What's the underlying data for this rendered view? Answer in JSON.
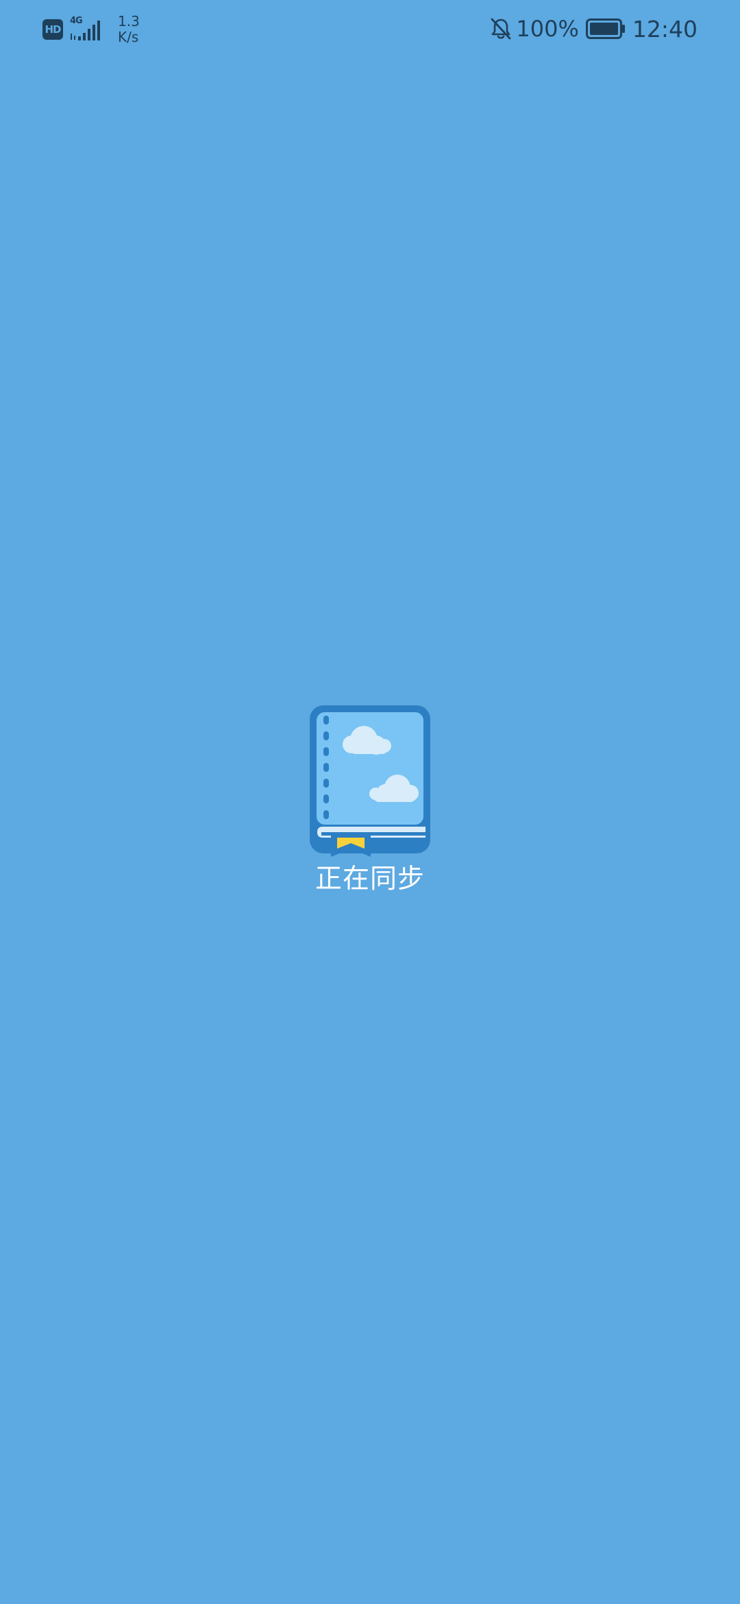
{
  "status_bar": {
    "hd_label": "HD",
    "network_label": "4G",
    "speed_value": "1.3",
    "speed_unit": "K/s",
    "battery_percent": "100%",
    "time": "12:40",
    "icons": {
      "hd": "hd-icon",
      "signal": "signal-icon",
      "notifications_off": "bell-off-icon",
      "battery": "battery-icon"
    }
  },
  "main": {
    "logo_icon": "book-icon",
    "sync_text": "正在同步"
  },
  "colors": {
    "background": "#5DA9E1",
    "status_text": "#1E3F5A",
    "book_border": "#2D7FC4",
    "book_page": "#79C4F4",
    "bookmark": "#F7D13B",
    "text": "#FFFFFF"
  }
}
